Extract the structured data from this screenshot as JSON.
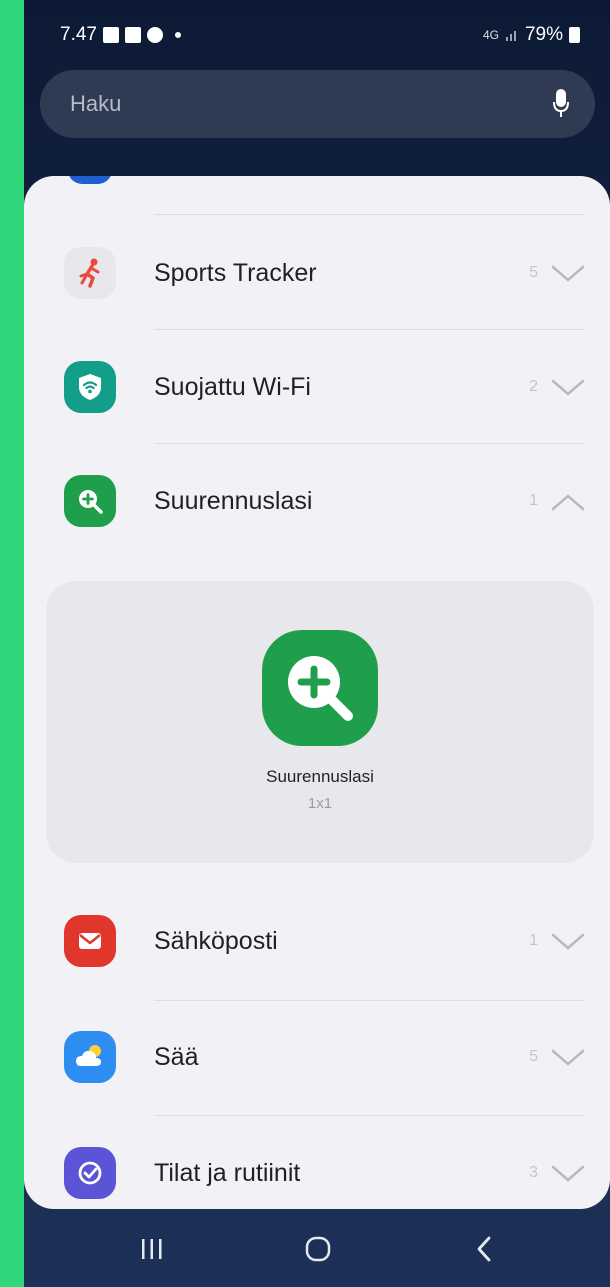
{
  "status_bar": {
    "time": "7.47",
    "signal_label": "4G",
    "battery": "79%"
  },
  "search": {
    "placeholder": "Haku"
  },
  "apps": [
    {
      "name": "Sports Tracker",
      "count": "5",
      "icon": "sports-tracker-icon",
      "color": "#e94b3c",
      "expanded": false
    },
    {
      "name": "Suojattu Wi-Fi",
      "count": "2",
      "icon": "secure-wifi-icon",
      "color": "#139e8a",
      "expanded": false
    },
    {
      "name": "Suurennuslasi",
      "count": "1",
      "icon": "magnifier-icon",
      "color": "#1f9f4b",
      "expanded": true
    },
    {
      "name": "Sähköposti",
      "count": "1",
      "icon": "email-icon",
      "color": "#e0362c",
      "expanded": false
    },
    {
      "name": "Sää",
      "count": "5",
      "icon": "weather-icon",
      "color": "#2d8df0",
      "expanded": false
    },
    {
      "name": "Tilat ja rutiinit",
      "count": "3",
      "icon": "modes-routines-icon",
      "color": "#5b54d6",
      "expanded": false
    }
  ],
  "widget": {
    "name": "Suurennuslasi",
    "size": "1x1",
    "icon": "magnifier-plus-icon"
  },
  "navbar": {
    "recents": "recents-icon",
    "home": "home-icon",
    "back": "back-icon"
  }
}
